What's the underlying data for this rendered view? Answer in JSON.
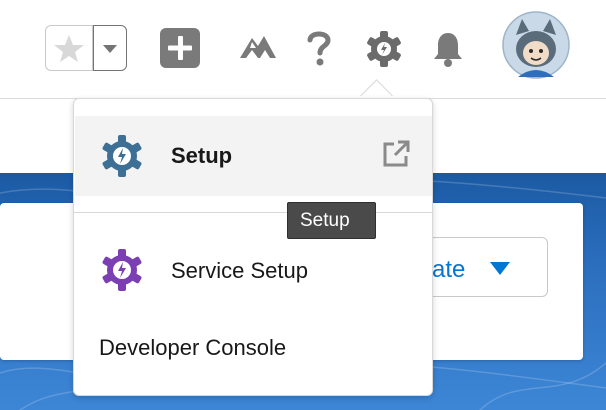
{
  "header": {
    "icons": [
      "star-icon",
      "chevron-down-icon",
      "add-icon",
      "trailhead-icon",
      "help-icon",
      "gear-icon",
      "bell-icon",
      "avatar"
    ]
  },
  "menu": {
    "items": [
      {
        "label": "Setup",
        "icon": "setup-gear-icon",
        "trailing_icon": "external-link-icon"
      },
      {
        "label": "Service Setup",
        "icon": "service-setup-gear-icon"
      },
      {
        "label": "Developer Console"
      }
    ],
    "tooltip": "Setup"
  },
  "background": {
    "create_label": "ate"
  },
  "colors": {
    "setup_gear": "#3e6f95",
    "service_gear": "#7b3fb3",
    "accent_blue": "#0176d3",
    "icon_grey": "#7a7a7a"
  }
}
